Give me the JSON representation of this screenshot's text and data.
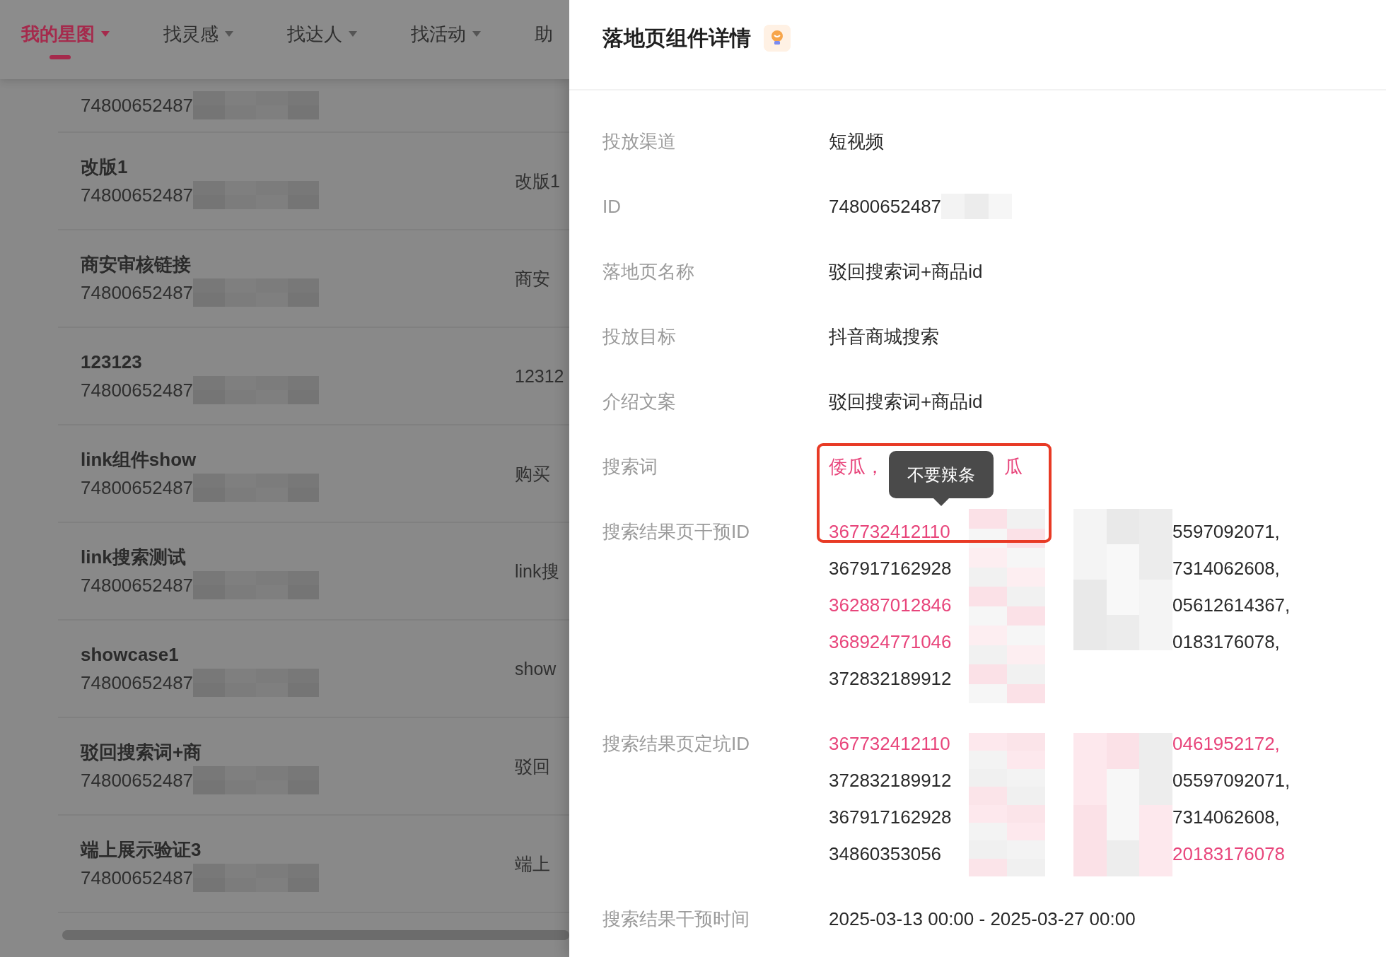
{
  "nav": {
    "tabs": [
      {
        "label": "我的星图",
        "selected": true,
        "dropdown": true
      },
      {
        "label": "找灵感",
        "selected": false,
        "dropdown": true
      },
      {
        "label": "找达人",
        "selected": false,
        "dropdown": true
      },
      {
        "label": "找活动",
        "selected": false,
        "dropdown": true
      },
      {
        "label": "助",
        "selected": false,
        "dropdown": false
      }
    ]
  },
  "list": {
    "rows": [
      {
        "id": "74800652487",
        "redacted": true
      },
      {
        "title": "改版1",
        "id": "74800652487",
        "redacted": true,
        "column_2": "改版1"
      },
      {
        "title": "商安审核链接",
        "id": "74800652487",
        "redacted": true,
        "column_2": "商安"
      },
      {
        "title": "123123",
        "id": "74800652487",
        "redacted": true,
        "column_2": "12312"
      },
      {
        "title": "link组件show",
        "id": "74800652487",
        "redacted": true,
        "column_2": "购买"
      },
      {
        "title": "link搜索测试",
        "id": "74800652487",
        "redacted": true,
        "column_2": "link搜"
      },
      {
        "title": "showcase1",
        "id": "74800652487",
        "redacted": true,
        "column_2": "show"
      },
      {
        "title": "驳回搜索词+商",
        "id": "74800652487",
        "redacted": true,
        "column_2": "驳回"
      },
      {
        "title": "端上展示验证3",
        "id": "74800652487",
        "redacted": true,
        "column_2": "端上"
      }
    ]
  },
  "drawer": {
    "title": "落地页组件详情",
    "fields": [
      {
        "label": "投放渠道",
        "kind": "text",
        "value": "短视频"
      },
      {
        "label": "ID",
        "kind": "text",
        "value": "74800652487",
        "redacted": true
      },
      {
        "label": "落地页名称",
        "kind": "text",
        "value": "驳回搜索词+商品id"
      },
      {
        "label": "投放目标",
        "kind": "text",
        "value": "抖音商城搜索"
      },
      {
        "label": "介绍文案",
        "kind": "text",
        "value": "驳回搜索词+商品id"
      },
      {
        "label": "搜索词",
        "kind": "keywords",
        "keywords": [
          {
            "text": "倭瓜，"
          },
          {
            "text": "瓜"
          }
        ],
        "tooltip": "不要辣条"
      },
      {
        "label": "搜索结果页干预ID",
        "kind": "id_list",
        "lines": [
          {
            "start": "367732412110",
            "end": "5597092071,",
            "highlighted": true,
            "end_highlighted": false
          },
          {
            "start": "367917162928",
            "end": "7314062608,",
            "highlighted": false,
            "end_highlighted": false
          },
          {
            "start": "362887012846",
            "end": "05612614367,",
            "highlighted": true,
            "end_highlighted": false
          },
          {
            "start": "368924771046",
            "end": "0183176078,",
            "highlighted": true,
            "end_highlighted": false
          },
          {
            "start": "372832189912",
            "highlighted": false
          }
        ]
      },
      {
        "label": "搜索结果页定坑ID",
        "kind": "id_list",
        "lines": [
          {
            "start": "367732412110",
            "end": "0461952172,",
            "highlighted": true,
            "end_highlighted": true
          },
          {
            "start": "372832189912",
            "end": "05597092071,",
            "highlighted": false,
            "end_highlighted": false
          },
          {
            "start": "367917162928",
            "end": "7314062608,",
            "highlighted": false,
            "end_highlighted": false
          },
          {
            "start": "34860353056",
            "end": "20183176078",
            "highlighted": false,
            "end_highlighted": true
          }
        ]
      },
      {
        "label": "搜索结果干预时间",
        "kind": "text",
        "value": "2025-03-13 00:00 - 2025-03-27 00:00"
      }
    ]
  }
}
